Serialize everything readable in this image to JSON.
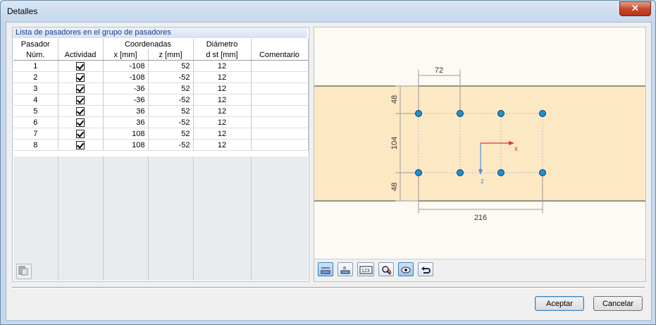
{
  "window": {
    "title": "Detalles",
    "close_label": "✕"
  },
  "panel": {
    "title": "Lista de pasadores en el grupo de pasadores"
  },
  "table": {
    "header_top": [
      "Pasador",
      "",
      "Coordenadas",
      "Diámetro",
      ""
    ],
    "header_bottom": [
      "Núm.",
      "Actividad",
      "x [mm]",
      "z [mm]",
      "d st [mm]",
      "Comentario"
    ],
    "rows": [
      {
        "num": "1",
        "active": true,
        "x": "-108",
        "z": "52",
        "d": "12",
        "comment": ""
      },
      {
        "num": "2",
        "active": true,
        "x": "-108",
        "z": "-52",
        "d": "12",
        "comment": ""
      },
      {
        "num": "3",
        "active": true,
        "x": "-36",
        "z": "52",
        "d": "12",
        "comment": ""
      },
      {
        "num": "4",
        "active": true,
        "x": "-36",
        "z": "-52",
        "d": "12",
        "comment": ""
      },
      {
        "num": "5",
        "active": true,
        "x": "36",
        "z": "52",
        "d": "12",
        "comment": ""
      },
      {
        "num": "6",
        "active": true,
        "x": "36",
        "z": "-52",
        "d": "12",
        "comment": ""
      },
      {
        "num": "7",
        "active": true,
        "x": "108",
        "z": "52",
        "d": "12",
        "comment": ""
      },
      {
        "num": "8",
        "active": true,
        "x": "108",
        "z": "-52",
        "d": "12",
        "comment": ""
      }
    ]
  },
  "drawing": {
    "dim_spacing": "72",
    "dim_top": "48",
    "dim_middle": "104",
    "dim_bottom": "48",
    "dim_total": "216",
    "axis_x": "x",
    "axis_z": "z",
    "colors": {
      "beam": "#fde8c4",
      "dowel": "#1e90d0",
      "axis_x": "#e53030",
      "axis_z": "#4a8fe0"
    }
  },
  "toolbar": {
    "icons": [
      "dimension-icon",
      "label-icon",
      "numbering-icon",
      "zoom-reset-icon",
      "view-icon",
      "undo-icon"
    ]
  },
  "buttons": {
    "ok": "Aceptar",
    "cancel": "Cancelar"
  }
}
